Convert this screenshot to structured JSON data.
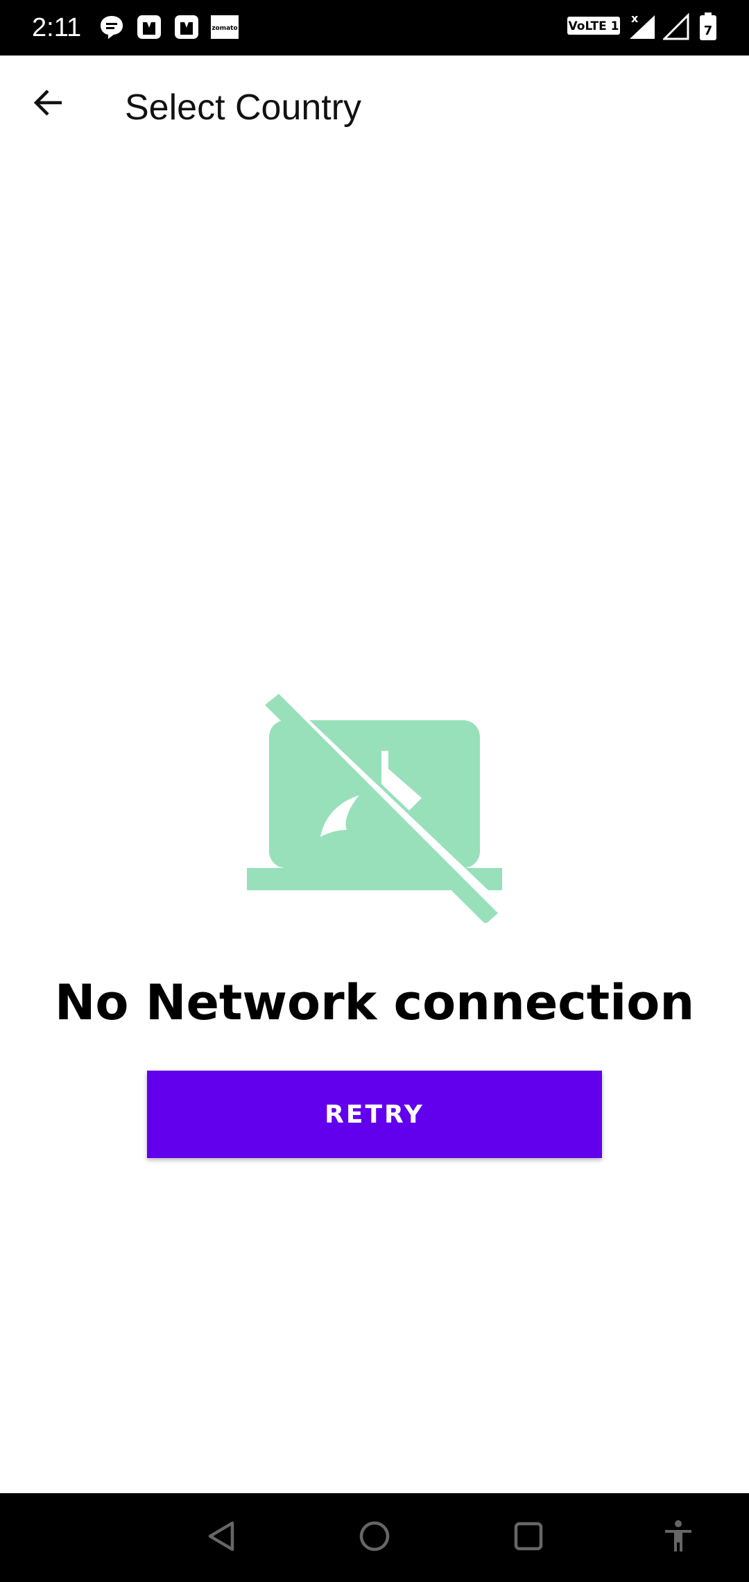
{
  "status_bar": {
    "time": "2:11",
    "notification_icons": [
      "chat-bubble-icon",
      "app-icon",
      "app-icon",
      "zomato-icon"
    ],
    "zomato_label": "zomato",
    "volte_label": "VoLTE 1",
    "signal_icons": [
      "signal-x-icon",
      "signal-empty-icon"
    ],
    "battery_level": "7"
  },
  "app_bar": {
    "title": "Select Country",
    "back_icon": "arrow-back-icon"
  },
  "empty_state": {
    "illustration": "no-network-laptop-icon",
    "illustration_color": "#97e0ba",
    "title": "No Network connection",
    "retry_label": "RETRY",
    "retry_color": "#6200ee"
  },
  "nav_bar": {
    "buttons": [
      "back-triangle-icon",
      "home-circle-icon",
      "recents-square-icon",
      "accessibility-icon"
    ]
  }
}
